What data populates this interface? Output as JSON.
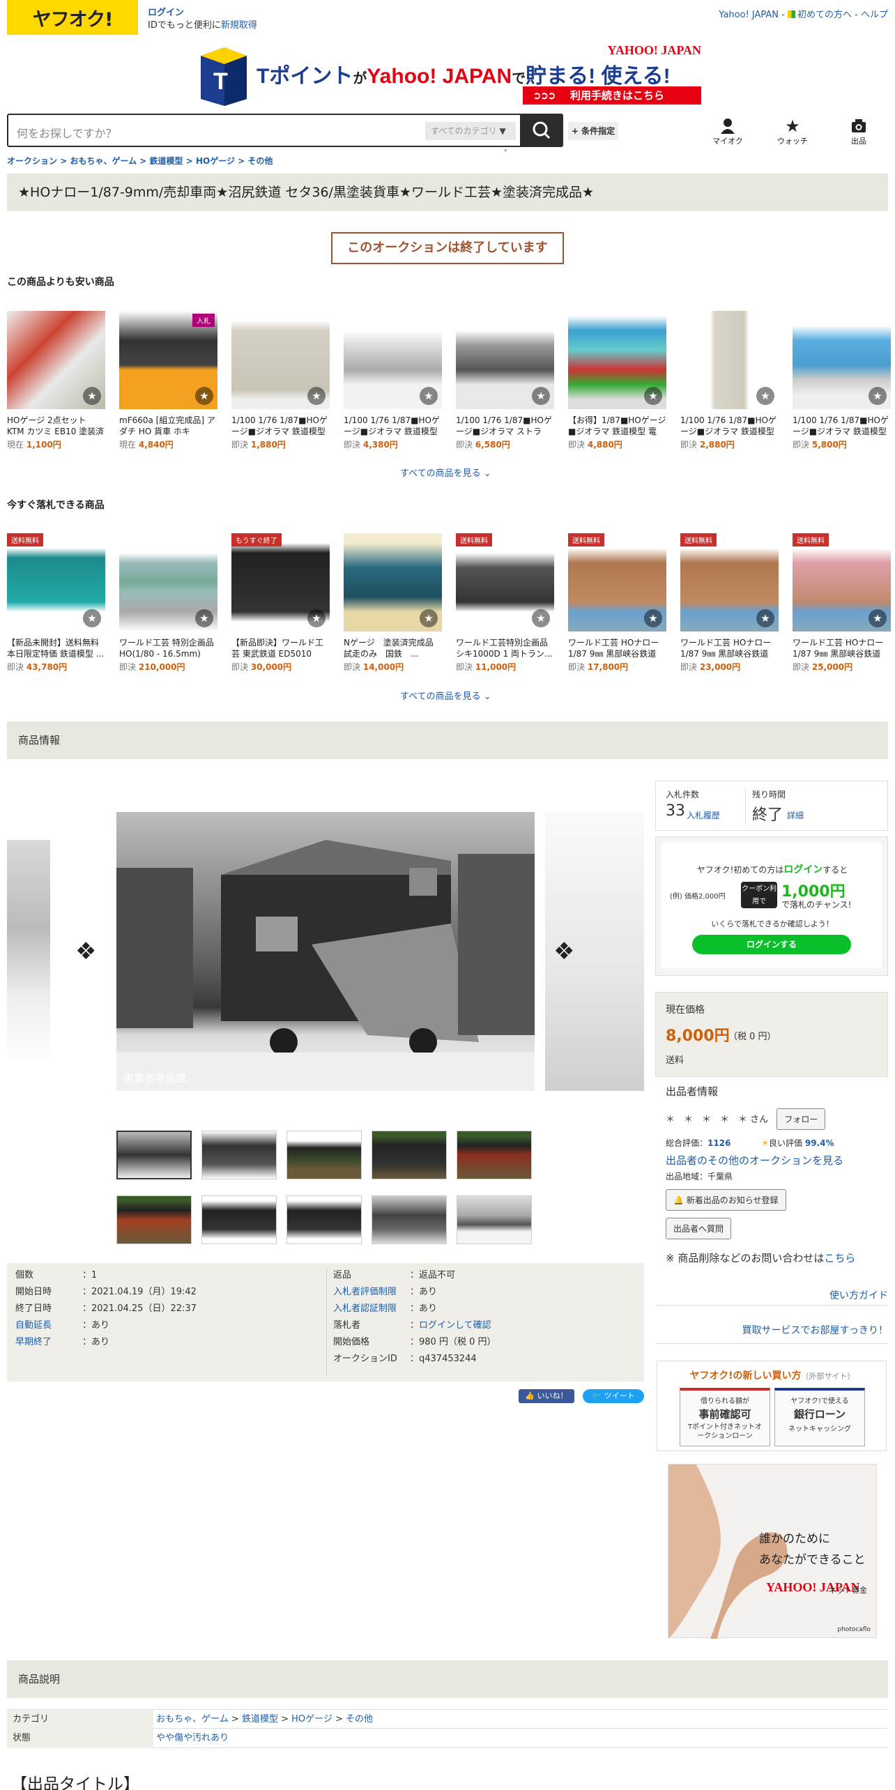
{
  "header": {
    "logo": "ヤフオク!",
    "login": "ログイン",
    "login_sub_pre": "IDでもっと便利に",
    "login_sub_link": "新規取得",
    "top_link1": "Yahoo! JAPAN",
    "top_link2": "初めての方へ",
    "top_link3": "ヘルプ"
  },
  "banner": {
    "brand": "YAHOO! JAPAN",
    "line_a": "Tポイント",
    "line_b": "が",
    "line_c": "Yahoo! JAPAN",
    "line_d": "で",
    "line_e": "貯まる! 使える!",
    "cta": "利用手続きはこちら"
  },
  "search": {
    "placeholder": "何をお探しですか？",
    "category": "すべてのカテゴリ",
    "cond": "+ 条件指定"
  },
  "nav": {
    "myauc": "マイオク",
    "watch": "ウォッチ",
    "sell": "出品"
  },
  "breadcrumb": [
    "オークション",
    "おもちゃ、ゲーム",
    "鉄道模型",
    "HOゲージ",
    "その他"
  ],
  "title": "★HOナロー1/87-9mm/売却車両★沼尻鉄道 セタ36/黒塗装貨車★ワールド工芸★塗装済完成品★",
  "ended": "このオークションは終了しています",
  "cheaper": {
    "heading": "この商品よりも安い商品",
    "items": [
      {
        "name": "HOゲージ 2点セット KTM カツミ EB10 塗装済完...",
        "label": "現在",
        "price": "1,100円",
        "badge": ""
      },
      {
        "name": "mF660a [組立完成品] アダチ HO 貨車 ホキ5700...",
        "label": "現在",
        "price": "4,840円",
        "badge": "入札"
      },
      {
        "name": "1/100 1/76 1/87■HOゲージ■ジオラマ 鉄道模型 ...",
        "label": "即決",
        "price": "1,880円",
        "badge": ""
      },
      {
        "name": "1/100 1/76 1/87■HOゲージ■ジオラマ 鉄道模型 ...",
        "label": "即決",
        "price": "4,380円",
        "badge": ""
      },
      {
        "name": "1/100 1/76 1/87■HOゲージ■ジオラマ ストラク...",
        "label": "即決",
        "price": "6,580円",
        "badge": ""
      },
      {
        "name": "【お得】1/87■HOゲージ■ジオラマ 鉄道模型 電車...",
        "label": "即決",
        "price": "4,880円",
        "badge": ""
      },
      {
        "name": "1/100 1/76 1/87■HOゲージ■ジオラマ 鉄道模型 ...",
        "label": "即決",
        "price": "2,880円",
        "badge": ""
      },
      {
        "name": "1/100 1/76 1/87■HOゲージ■ジオラマ 鉄道模型 ...",
        "label": "即決",
        "price": "5,800円",
        "badge": ""
      }
    ],
    "more": "すべての商品を見る"
  },
  "buynow": {
    "heading": "今すぐ落札できる商品",
    "items": [
      {
        "name": "【新品未開封】送料無料 本日限定特価 鉄道模型 ...",
        "label": "即決",
        "price": "43,780円",
        "badge": "送料無料"
      },
      {
        "name": "ワールド工芸 特別企画品 HO(1/80 - 16.5mm) 塗...",
        "label": "即決",
        "price": "210,000円",
        "badge": ""
      },
      {
        "name": "【新品即決】ワールド工芸 東武鉄道 ED5010 前...",
        "label": "即決",
        "price": "30,000円",
        "badge": "もうすぐ終了"
      },
      {
        "name": "Nゲージ　塗装済完成品　試走のみ　国鉄　...",
        "label": "即決",
        "price": "14,000円",
        "badge": ""
      },
      {
        "name": "ワールド工芸特別企画品 シキ1000D 1 両トラン...",
        "label": "即決",
        "price": "11,000円",
        "badge": "送料無料"
      },
      {
        "name": "ワールド工芸 HOナロー 1/87 9㎜ 黒部峡谷鉄道 ...",
        "label": "即決",
        "price": "17,800円",
        "badge": "送料無料"
      },
      {
        "name": "ワールド工芸 HOナロー 1/87 9㎜ 黒部峡谷鉄道 ...",
        "label": "即決",
        "price": "23,000円",
        "badge": "送料無料"
      },
      {
        "name": "ワールド工芸 HOナロー 1/87 9㎜ 黒部峡谷鉄道 ...",
        "label": "即決",
        "price": "25,000円",
        "badge": "送料無料"
      }
    ],
    "more": "すべての商品を見る"
  },
  "section_info": "商品情報",
  "image_caption": "実車参考画像",
  "details": {
    "left": [
      {
        "k": "個数",
        "v": "1",
        "link": false
      },
      {
        "k": "開始日時",
        "v": "2021.04.19（月）19:42",
        "link": false
      },
      {
        "k": "終了日時",
        "v": "2021.04.25（日）22:37",
        "link": false
      },
      {
        "k": "自動延長",
        "v": "あり",
        "link": true
      },
      {
        "k": "早期終了",
        "v": "あり",
        "link": true
      }
    ],
    "right": [
      {
        "k": "返品",
        "v": "返品不可",
        "link": false,
        "vlink": false
      },
      {
        "k": "入札者評価制限",
        "v": "あり",
        "link": true,
        "vlink": false
      },
      {
        "k": "入札者認証制限",
        "v": "あり",
        "link": true,
        "vlink": false
      },
      {
        "k": "落札者",
        "v": "ログインして確認",
        "link": false,
        "vlink": true
      },
      {
        "k": "開始価格",
        "v": "980 円（税 0 円）",
        "link": false,
        "vlink": false
      },
      {
        "k": "オークションID",
        "v": "q437453244",
        "link": false,
        "vlink": false
      }
    ]
  },
  "share": {
    "like": "いいね！",
    "tweet": "ツイート"
  },
  "bid": {
    "count_label": "入札件数",
    "count": "33",
    "history": "入札履歴",
    "time_label": "残り時間",
    "time": "終了",
    "detail": "詳細"
  },
  "loginbox": {
    "l1_pre": "ヤフオク!初めての方は",
    "l1_link": "ログイン",
    "l1_post": "すると",
    "ex": "(例) 価格2,000円",
    "coupon": "クーポン利用で",
    "amount": "1,000円",
    "chance": "で落札のチャンス!",
    "check": "いくらで落札できるか確認しよう！",
    "button": "ログインする"
  },
  "price": {
    "label": "現在価格",
    "value": "8,000円",
    "tax": "（税 0 円）",
    "shipping": "送料"
  },
  "seller": {
    "heading": "出品者情報",
    "name": "＊　＊　＊　＊　＊",
    "san": "さん",
    "follow": "フォロー",
    "rating_label": "総合評価：",
    "rating": "1126",
    "good_label": "良い評価",
    "good": "99.4%",
    "other": "出品者のその他のオークションを見る",
    "region": "出品地域：千葉県",
    "notify": "新着出品のお知らせ登録",
    "question": "出品者へ質問"
  },
  "report": {
    "pre": "※ 商品削除などのお問い合わせは",
    "link": "こちら"
  },
  "guide": "使い方ガイド",
  "buyservice": "買取サービスでお部屋すっきり！",
  "newbuy": {
    "heading": "ヤフオク!の新しい買い方",
    "external": "（外部サイト）",
    "a_top": "借りられる額が",
    "a_main": "事前確認可",
    "a_sub": "Tポイント付きネットオークションローン",
    "b_top": "ヤフオク!で使える",
    "b_main": "銀行ローン",
    "b_sub": "ネットキャッシング"
  },
  "ad": {
    "line1": "誰かのために",
    "line2": "あなたができること",
    "brand": "YAHOO! JAPAN",
    "tag": "ネット募金",
    "credit": "photocaflo"
  },
  "section_desc": "商品説明",
  "desc": {
    "cat_label": "カテゴリ",
    "cat": [
      "おもちゃ、ゲーム",
      "鉄道模型",
      "HOゲージ",
      "その他"
    ],
    "state_label": "状態",
    "state": "やや傷や汚れあり"
  },
  "listing_title": "【出品タイトル】",
  "colors": {
    "brand_yellow": "#ffd800",
    "accent": "#d05f0b",
    "link": "#1f5da8",
    "green": "#1fb71f",
    "panel": "#e8e7e0"
  }
}
